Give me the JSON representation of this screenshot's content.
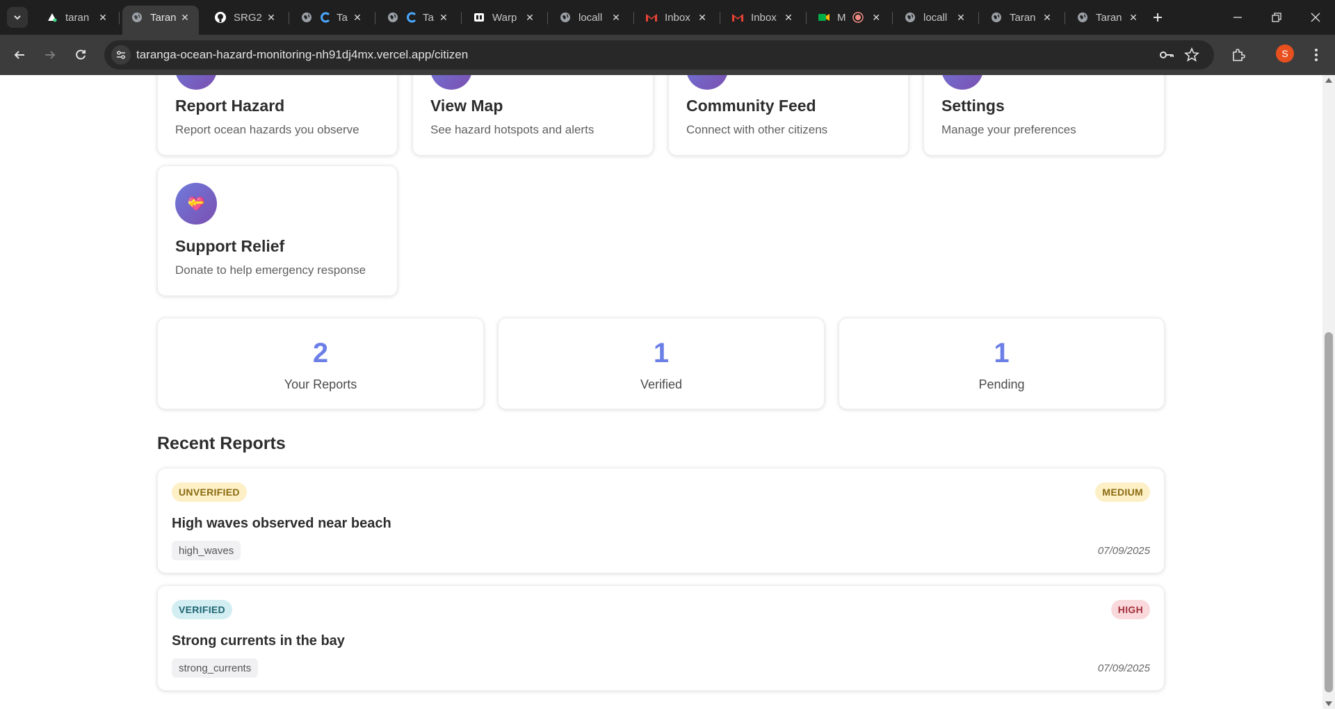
{
  "browser": {
    "tabs": [
      {
        "title": "taran",
        "icon": "triangle-logo-icon",
        "active": false
      },
      {
        "title": "Taran",
        "icon": "globe-icon",
        "active": true
      },
      {
        "title": "SRG2",
        "icon": "github-icon",
        "active": false
      },
      {
        "title": "Ta",
        "icon": "globe-icon",
        "active": false
      },
      {
        "title": "Ta",
        "icon": "globe-icon",
        "active": false
      },
      {
        "title": "Warp",
        "icon": "warp-icon",
        "active": false
      },
      {
        "title": "locall",
        "icon": "globe-icon",
        "active": false
      },
      {
        "title": "Inbox",
        "icon": "gmail-icon",
        "active": false
      },
      {
        "title": "Inbox",
        "icon": "gmail-icon",
        "active": false
      },
      {
        "title": "M",
        "icon": "meet-icon",
        "active": false
      },
      {
        "title": "locall",
        "icon": "globe-icon",
        "active": false
      },
      {
        "title": "Taran",
        "icon": "globe-icon",
        "active": false
      },
      {
        "title": "Taran",
        "icon": "globe-icon",
        "active": false
      }
    ],
    "url": "taranga-ocean-hazard-monitoring-nh91dj4mx.vercel.app/citizen",
    "profile_initial": "S"
  },
  "actions": [
    {
      "title": "Report Hazard",
      "desc": "Report ocean hazards you observe"
    },
    {
      "title": "View Map",
      "desc": "See hazard hotspots and alerts"
    },
    {
      "title": "Community Feed",
      "desc": "Connect with other citizens"
    },
    {
      "title": "Settings",
      "desc": "Manage your preferences"
    },
    {
      "title": "Support Relief",
      "desc": "Donate to help emergency response",
      "emoji": "💝"
    }
  ],
  "stats": [
    {
      "value": "2",
      "label": "Your Reports"
    },
    {
      "value": "1",
      "label": "Verified"
    },
    {
      "value": "1",
      "label": "Pending"
    }
  ],
  "recent": {
    "title": "Recent Reports",
    "reports": [
      {
        "status": "UNVERIFIED",
        "severity": "MEDIUM",
        "title": "High waves observed near beach",
        "tag": "high_waves",
        "date": "07/09/2025"
      },
      {
        "status": "VERIFIED",
        "severity": "HIGH",
        "title": "Strong currents in the bay",
        "tag": "strong_currents",
        "date": "07/09/2025"
      }
    ]
  },
  "colors": {
    "accent": "#6c7fe6",
    "unverified_bg": "#fdf0c7",
    "unverified_fg": "#8a6a10",
    "verified_bg": "#d2eef2",
    "verified_fg": "#1d6472",
    "medium_bg": "#fdf0c7",
    "medium_fg": "#8a6a10",
    "high_bg": "#f9d9dc",
    "high_fg": "#a3303a"
  }
}
